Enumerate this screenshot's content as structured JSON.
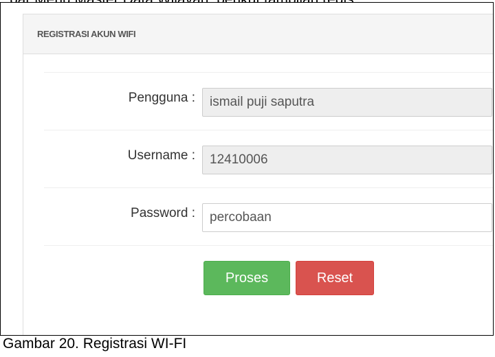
{
  "document": {
    "top_text": "bar Menu Master Data Wilayah, berikut tampilan regis",
    "caption": "Gambar 20. Registrasi WI-FI"
  },
  "panel": {
    "title": "REGISTRASI AKUN WIFI"
  },
  "form": {
    "pengguna": {
      "label": "Pengguna :",
      "value": "ismail puji saputra"
    },
    "username": {
      "label": "Username :",
      "value": "12410006"
    },
    "password": {
      "label": "Password :",
      "value": "percobaan"
    }
  },
  "buttons": {
    "submit_label": "Proses",
    "reset_label": "Reset"
  },
  "colors": {
    "success": "#5cb85c",
    "danger": "#d9534f",
    "readonly_bg": "#eeeeee",
    "heading_bg": "#f5f5f5"
  }
}
